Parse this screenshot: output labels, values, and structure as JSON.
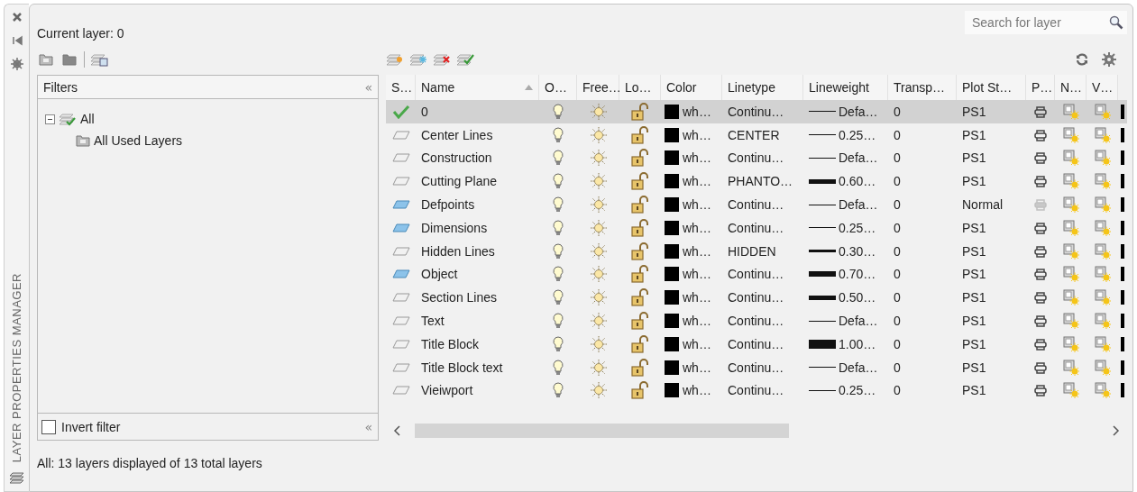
{
  "panel_title": "LAYER PROPERTIES MANAGER",
  "current_layer": "Current layer: 0",
  "search": {
    "placeholder": "Search for layer"
  },
  "filters": {
    "title": "Filters",
    "collapse_glyph": "«",
    "footer_collapse_glyph": "«",
    "tree": [
      {
        "label": "All",
        "expanded": true,
        "children": [
          {
            "label": "All Used Layers"
          }
        ]
      }
    ],
    "invert_filter": {
      "label": "Invert filter",
      "checked": false
    }
  },
  "columns": [
    {
      "label": "S…",
      "sorted": false
    },
    {
      "label": "Name",
      "sorted": true
    },
    {
      "label": "O…",
      "sorted": false
    },
    {
      "label": "Free…",
      "sorted": false
    },
    {
      "label": "Lo…",
      "sorted": false
    },
    {
      "label": "Color",
      "sorted": false
    },
    {
      "label": "Linetype",
      "sorted": false
    },
    {
      "label": "Lineweight",
      "sorted": false
    },
    {
      "label": "Transp…",
      "sorted": false
    },
    {
      "label": "Plot St…",
      "sorted": false
    },
    {
      "label": "P…",
      "sorted": false
    },
    {
      "label": "N…",
      "sorted": false
    },
    {
      "label": "V…",
      "sorted": false
    }
  ],
  "rows": [
    {
      "status_icon": {
        "kind": "current"
      },
      "name": "0",
      "color_name": "wh…",
      "linetype": "Continu…",
      "weight_sample": {
        "kind": "thin"
      },
      "lineweight": "Defa…",
      "transparency": "0",
      "plot_style": "PS1",
      "plot": true,
      "selected": true
    },
    {
      "status_icon": {
        "kind": "unused"
      },
      "name": "Center Lines",
      "color_name": "wh…",
      "linetype": "CENTER",
      "weight_sample": {
        "kind": "thin"
      },
      "lineweight": "0.25…",
      "transparency": "0",
      "plot_style": "PS1",
      "plot": true,
      "selected": false
    },
    {
      "status_icon": {
        "kind": "unused"
      },
      "name": "Construction",
      "color_name": "wh…",
      "linetype": "Continu…",
      "weight_sample": {
        "kind": "thin"
      },
      "lineweight": "Defa…",
      "transparency": "0",
      "plot_style": "PS1",
      "plot": true,
      "selected": false
    },
    {
      "status_icon": {
        "kind": "unused"
      },
      "name": "Cutting Plane",
      "color_name": "wh…",
      "linetype": "PHANTO…",
      "weight_sample": {
        "kind": "thick"
      },
      "lineweight": "0.60…",
      "transparency": "0",
      "plot_style": "PS1",
      "plot": true,
      "selected": false
    },
    {
      "status_icon": {
        "kind": "used"
      },
      "name": "Defpoints",
      "color_name": "wh…",
      "linetype": "Continu…",
      "weight_sample": {
        "kind": "thin"
      },
      "lineweight": "Defa…",
      "transparency": "0",
      "plot_style": "Normal",
      "plot": false,
      "selected": false
    },
    {
      "status_icon": {
        "kind": "used"
      },
      "name": "Dimensions",
      "color_name": "wh…",
      "linetype": "Continu…",
      "weight_sample": {
        "kind": "thin"
      },
      "lineweight": "0.25…",
      "transparency": "0",
      "plot_style": "PS1",
      "plot": true,
      "selected": false
    },
    {
      "status_icon": {
        "kind": "unused"
      },
      "name": "Hidden Lines",
      "color_name": "wh…",
      "linetype": "HIDDEN",
      "weight_sample": {
        "kind": "medium"
      },
      "lineweight": "0.30…",
      "transparency": "0",
      "plot_style": "PS1",
      "plot": true,
      "selected": false
    },
    {
      "status_icon": {
        "kind": "used"
      },
      "name": "Object",
      "color_name": "wh…",
      "linetype": "Continu…",
      "weight_sample": {
        "kind": "heavy"
      },
      "lineweight": "0.70…",
      "transparency": "0",
      "plot_style": "PS1",
      "plot": true,
      "selected": false
    },
    {
      "status_icon": {
        "kind": "unused"
      },
      "name": "Section Lines",
      "color_name": "wh…",
      "linetype": "Continu…",
      "weight_sample": {
        "kind": "thick"
      },
      "lineweight": "0.50…",
      "transparency": "0",
      "plot_style": "PS1",
      "plot": true,
      "selected": false
    },
    {
      "status_icon": {
        "kind": "unused"
      },
      "name": "Text",
      "color_name": "wh…",
      "linetype": "Continu…",
      "weight_sample": {
        "kind": "thin"
      },
      "lineweight": "Defa…",
      "transparency": "0",
      "plot_style": "PS1",
      "plot": true,
      "selected": false
    },
    {
      "status_icon": {
        "kind": "unused"
      },
      "name": "Title Block",
      "color_name": "wh…",
      "linetype": "Continu…",
      "weight_sample": {
        "kind": "heaviest"
      },
      "lineweight": "1.00…",
      "transparency": "0",
      "plot_style": "PS1",
      "plot": true,
      "selected": false
    },
    {
      "status_icon": {
        "kind": "unused"
      },
      "name": "Title Block text",
      "color_name": "wh…",
      "linetype": "Continu…",
      "weight_sample": {
        "kind": "thin"
      },
      "lineweight": "Defa…",
      "transparency": "0",
      "plot_style": "PS1",
      "plot": true,
      "selected": false
    },
    {
      "status_icon": {
        "kind": "unused"
      },
      "name": "Vieiwport",
      "color_name": "wh…",
      "linetype": "Continu…",
      "weight_sample": {
        "kind": "thin"
      },
      "lineweight": "0.25…",
      "transparency": "0",
      "plot_style": "PS1",
      "plot": true,
      "selected": false
    }
  ],
  "status_bar": "All: 13 layers displayed of 13 total layers"
}
